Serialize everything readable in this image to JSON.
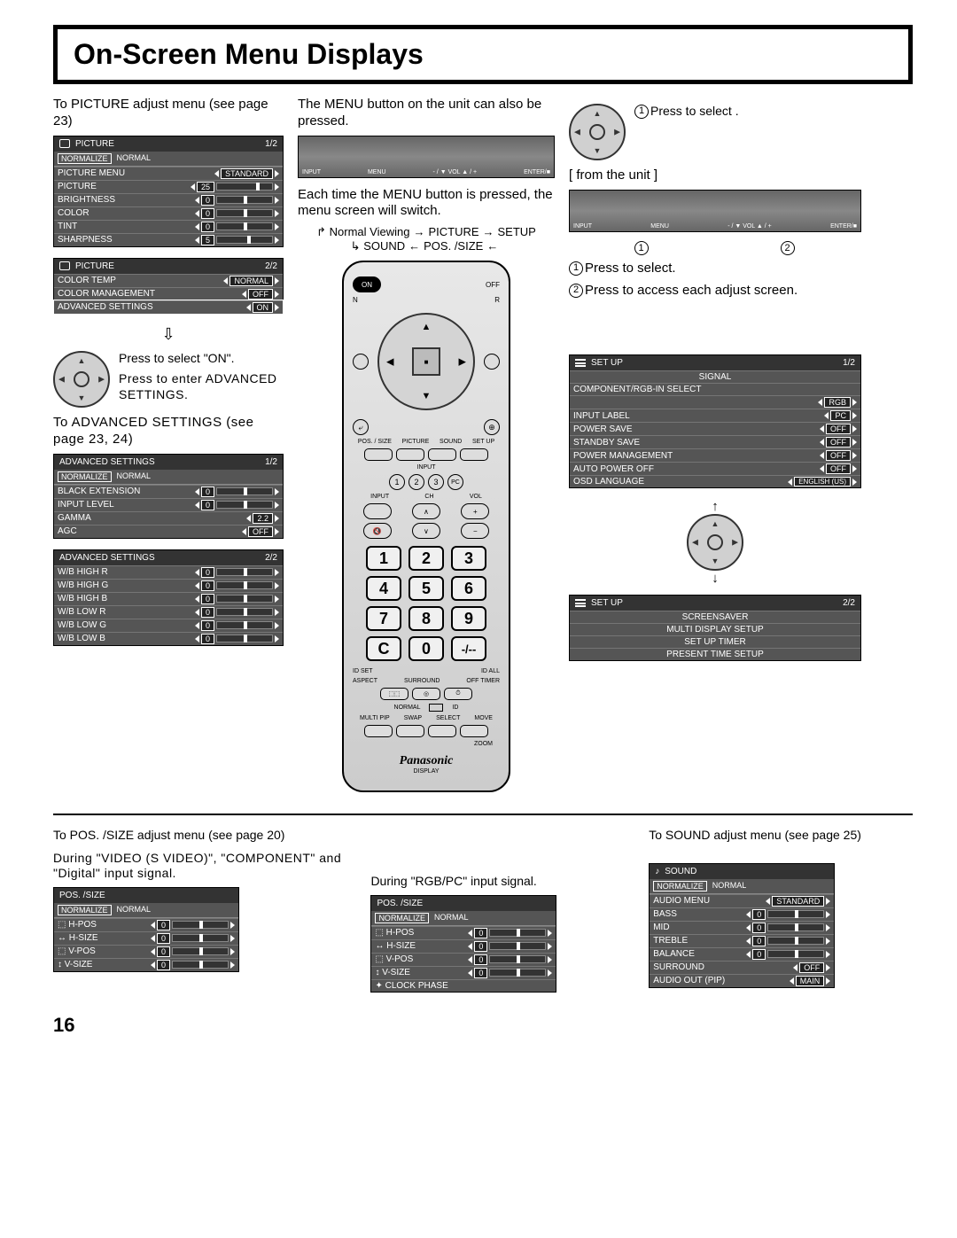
{
  "title": "On-Screen Menu Displays",
  "page_number": "16",
  "col1": {
    "to_picture": "To PICTURE adjust menu (see page 23)",
    "picture_menu_1": {
      "title": "PICTURE",
      "page": "1/2",
      "normalize": "NORMALIZE",
      "normal": "NORMAL",
      "rows": [
        {
          "label": "PICTURE MENU",
          "value": "STANDARD"
        },
        {
          "label": "PICTURE",
          "value": "25"
        },
        {
          "label": "BRIGHTNESS",
          "value": "0"
        },
        {
          "label": "COLOR",
          "value": "0"
        },
        {
          "label": "TINT",
          "value": "0"
        },
        {
          "label": "SHARPNESS",
          "value": "5"
        }
      ]
    },
    "picture_menu_2": {
      "title": "PICTURE",
      "page": "2/2",
      "rows": [
        {
          "label": "COLOR TEMP",
          "value": "NORMAL"
        },
        {
          "label": "COLOR MANAGEMENT",
          "value": "OFF"
        },
        {
          "label": "ADVANCED SETTINGS",
          "value": "ON"
        }
      ]
    },
    "press_on": "Press to select \"ON\".",
    "press_enter": "Press to enter ADVANCED SETTINGS.",
    "to_advanced": "To ADVANCED SETTINGS (see page 23, 24)",
    "adv_menu_1": {
      "title": "ADVANCED SETTINGS",
      "page": "1/2",
      "normalize": "NORMALIZE",
      "normal": "NORMAL",
      "rows": [
        {
          "label": "BLACK EXTENSION",
          "value": "0"
        },
        {
          "label": "INPUT LEVEL",
          "value": "0"
        },
        {
          "label": "GAMMA",
          "value": "2.2"
        },
        {
          "label": "AGC",
          "value": "OFF"
        }
      ]
    },
    "adv_menu_2": {
      "title": "ADVANCED SETTINGS",
      "page": "2/2",
      "rows": [
        {
          "label": "W/B HIGH R",
          "value": "0"
        },
        {
          "label": "W/B HIGH G",
          "value": "0"
        },
        {
          "label": "W/B HIGH B",
          "value": "0"
        },
        {
          "label": "W/B LOW R",
          "value": "0"
        },
        {
          "label": "W/B LOW G",
          "value": "0"
        },
        {
          "label": "W/B LOW B",
          "value": "0"
        }
      ]
    }
  },
  "col2": {
    "menu_note": "The MENU button on the unit can also be pressed.",
    "each_time": "Each time the MENU button is pressed, the menu screen will switch.",
    "nav1": "Normal Viewing",
    "nav2": "PICTURE",
    "nav3": "SETUP",
    "nav4": "SOUND",
    "nav5": "POS. /SIZE",
    "unit_labels": [
      "INPUT",
      "MENU",
      "- / ▼ VOL ▲ / +",
      "ENTER/■"
    ],
    "remote": {
      "on": "ON",
      "off": "OFF",
      "n": "N",
      "r": "R",
      "labels_row": [
        "POS. / SIZE",
        "PICTURE",
        "SOUND",
        "SET UP"
      ],
      "input_label": "INPUT",
      "small_nums": [
        "1",
        "2",
        "3"
      ],
      "pc": "PC",
      "input2": "INPUT",
      "ch": "CH",
      "vol": "VOL",
      "numpad": [
        "1",
        "2",
        "3",
        "4",
        "5",
        "6",
        "7",
        "8",
        "9",
        "C",
        "0",
        "-/--"
      ],
      "idset": "ID SET",
      "idall": "ID ALL",
      "aspect": "ASPECT",
      "surround": "SURROUND",
      "offtimer": "OFF TIMER",
      "normal": "NORMAL",
      "id": "ID",
      "multipip": "MULTI PIP",
      "swap": "SWAP",
      "select": "SELECT",
      "move": "MOVE",
      "zoom": "ZOOM",
      "brand": "Panasonic",
      "display": "DISPLAY"
    }
  },
  "col3": {
    "press_select": "Press to select .",
    "from_unit": "[ from the unit ]",
    "unit_labels": [
      "INPUT",
      "MENU",
      "- / ▼ VOL ▲ / +",
      "ENTER/■"
    ],
    "line1": "Press to select.",
    "line2": "Press to access each adjust screen.",
    "setup_menu_1": {
      "title": "SET UP",
      "page": "1/2",
      "rows_top": [
        "SIGNAL",
        "COMPONENT/RGB-IN SELECT"
      ],
      "rgb_val": "RGB",
      "rows": [
        {
          "label": "INPUT LABEL",
          "value": "PC"
        },
        {
          "label": "POWER SAVE",
          "value": "OFF"
        },
        {
          "label": "STANDBY SAVE",
          "value": "OFF"
        },
        {
          "label": "POWER MANAGEMENT",
          "value": "OFF"
        },
        {
          "label": "AUTO POWER OFF",
          "value": "OFF"
        },
        {
          "label": "OSD LANGUAGE",
          "value": "ENGLISH (US)"
        }
      ]
    },
    "setup_menu_2": {
      "title": "SET UP",
      "page": "2/2",
      "rows": [
        "SCREENSAVER",
        "MULTI DISPLAY SETUP",
        "SET UP TIMER",
        "PRESENT TIME SETUP"
      ]
    }
  },
  "bottom": {
    "to_pos": "To POS. /SIZE adjust menu (see page 20)",
    "during_video": "During \"VIDEO (S VIDEO)\", \"COMPONENT\" and \"Digital\" input signal.",
    "during_rgb": "During \"RGB/PC\" input signal.",
    "pos_menu_1": {
      "title": "POS. /SIZE",
      "normalize": "NORMALIZE",
      "normal": "NORMAL",
      "rows": [
        {
          "label": "H-POS",
          "value": "0"
        },
        {
          "label": "H-SIZE",
          "value": "0"
        },
        {
          "label": "V-POS",
          "value": "0"
        },
        {
          "label": "V-SIZE",
          "value": "0"
        }
      ]
    },
    "pos_menu_2": {
      "title": "POS. /SIZE",
      "normalize": "NORMALIZE",
      "normal": "NORMAL",
      "rows": [
        {
          "label": "H-POS",
          "value": "0"
        },
        {
          "label": "H-SIZE",
          "value": "0"
        },
        {
          "label": "V-POS",
          "value": "0"
        },
        {
          "label": "V-SIZE",
          "value": "0"
        },
        {
          "label": "CLOCK PHASE",
          "value": ""
        }
      ]
    },
    "to_sound": "To SOUND adjust menu (see page 25)",
    "sound_menu": {
      "title": "SOUND",
      "normalize": "NORMALIZE",
      "normal": "NORMAL",
      "rows": [
        {
          "label": "AUDIO MENU",
          "value": "STANDARD"
        },
        {
          "label": "BASS",
          "value": "0"
        },
        {
          "label": "MID",
          "value": "0"
        },
        {
          "label": "TREBLE",
          "value": "0"
        },
        {
          "label": "BALANCE",
          "value": "0"
        },
        {
          "label": "SURROUND",
          "value": "OFF"
        },
        {
          "label": "AUDIO OUT (PIP)",
          "value": "MAIN"
        }
      ]
    }
  }
}
